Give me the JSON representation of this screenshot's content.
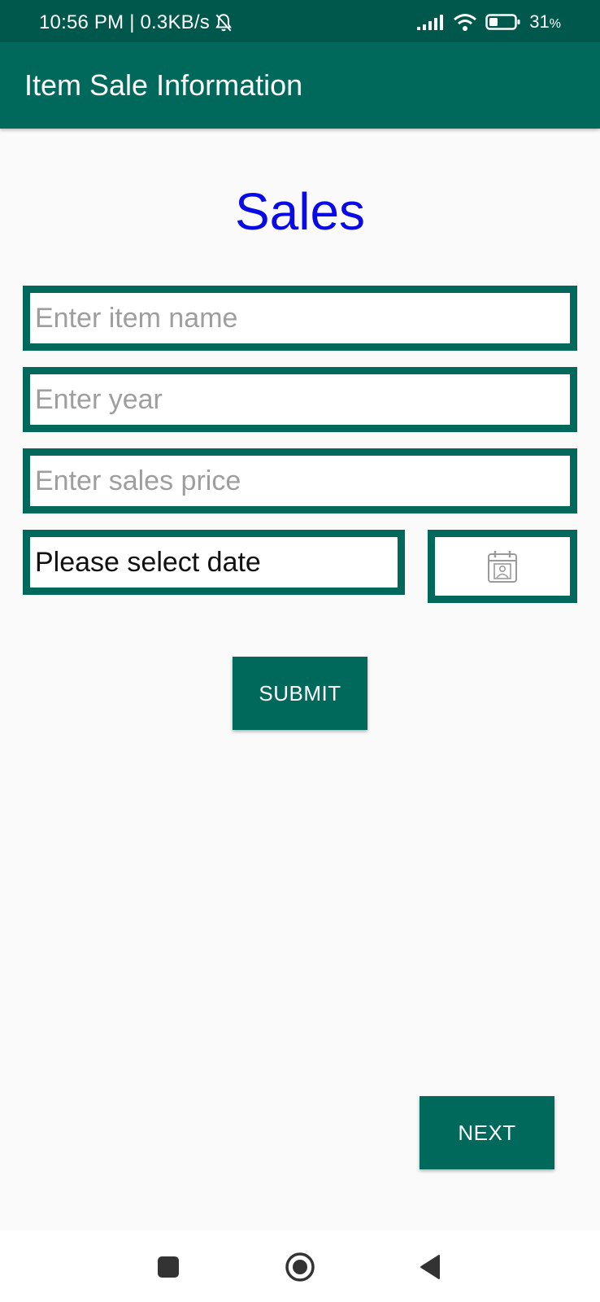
{
  "status_bar": {
    "time_speed": "10:56 PM | 0.3KB/s",
    "battery": "31",
    "battery_unit": "%",
    "icons": [
      "mute-bell-icon",
      "signal-icon",
      "wifi-icon",
      "battery-icon"
    ]
  },
  "app_bar": {
    "title": "Item Sale Information"
  },
  "main": {
    "heading": "Sales",
    "item_name": {
      "placeholder": "Enter item name",
      "value": ""
    },
    "year": {
      "placeholder": "Enter year",
      "value": ""
    },
    "sales_price": {
      "placeholder": "Enter sales price",
      "value": ""
    },
    "date_label": "Please select date",
    "calendar_icon": "calendar-icon",
    "submit_label": "SUBMIT",
    "next_label": "NEXT"
  },
  "nav": {
    "icons": [
      "recents-icon",
      "home-icon",
      "back-icon"
    ]
  },
  "colors": {
    "primary": "#00695c",
    "primary_dark": "#00574b",
    "heading": "#0a0ae6",
    "background": "#fafafa"
  }
}
